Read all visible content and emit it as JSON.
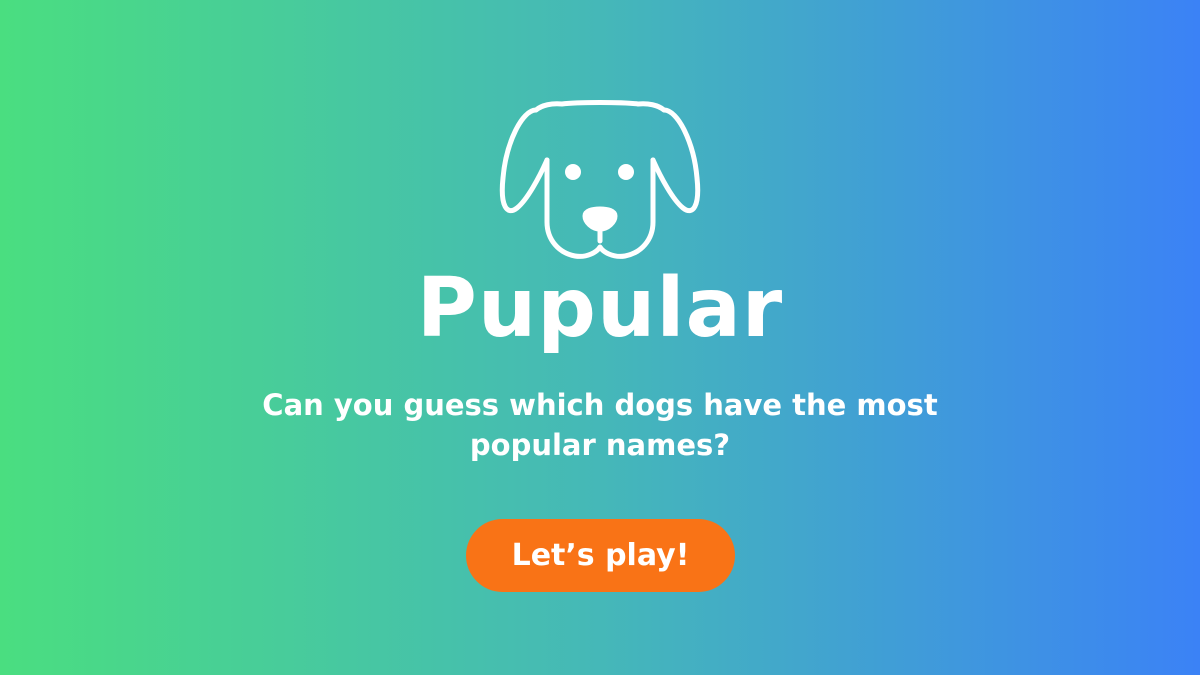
{
  "theme": {
    "gradient_start": "#4ade80",
    "gradient_mid": "#45b8b8",
    "gradient_end": "#3b82f6",
    "accent": "#f97316",
    "text": "#ffffff"
  },
  "hero": {
    "logo_icon": "dog-face-icon",
    "brand": "Pupular",
    "tagline": "Can you guess which dogs have the most popular names?",
    "cta_label": "Let’s play!"
  }
}
